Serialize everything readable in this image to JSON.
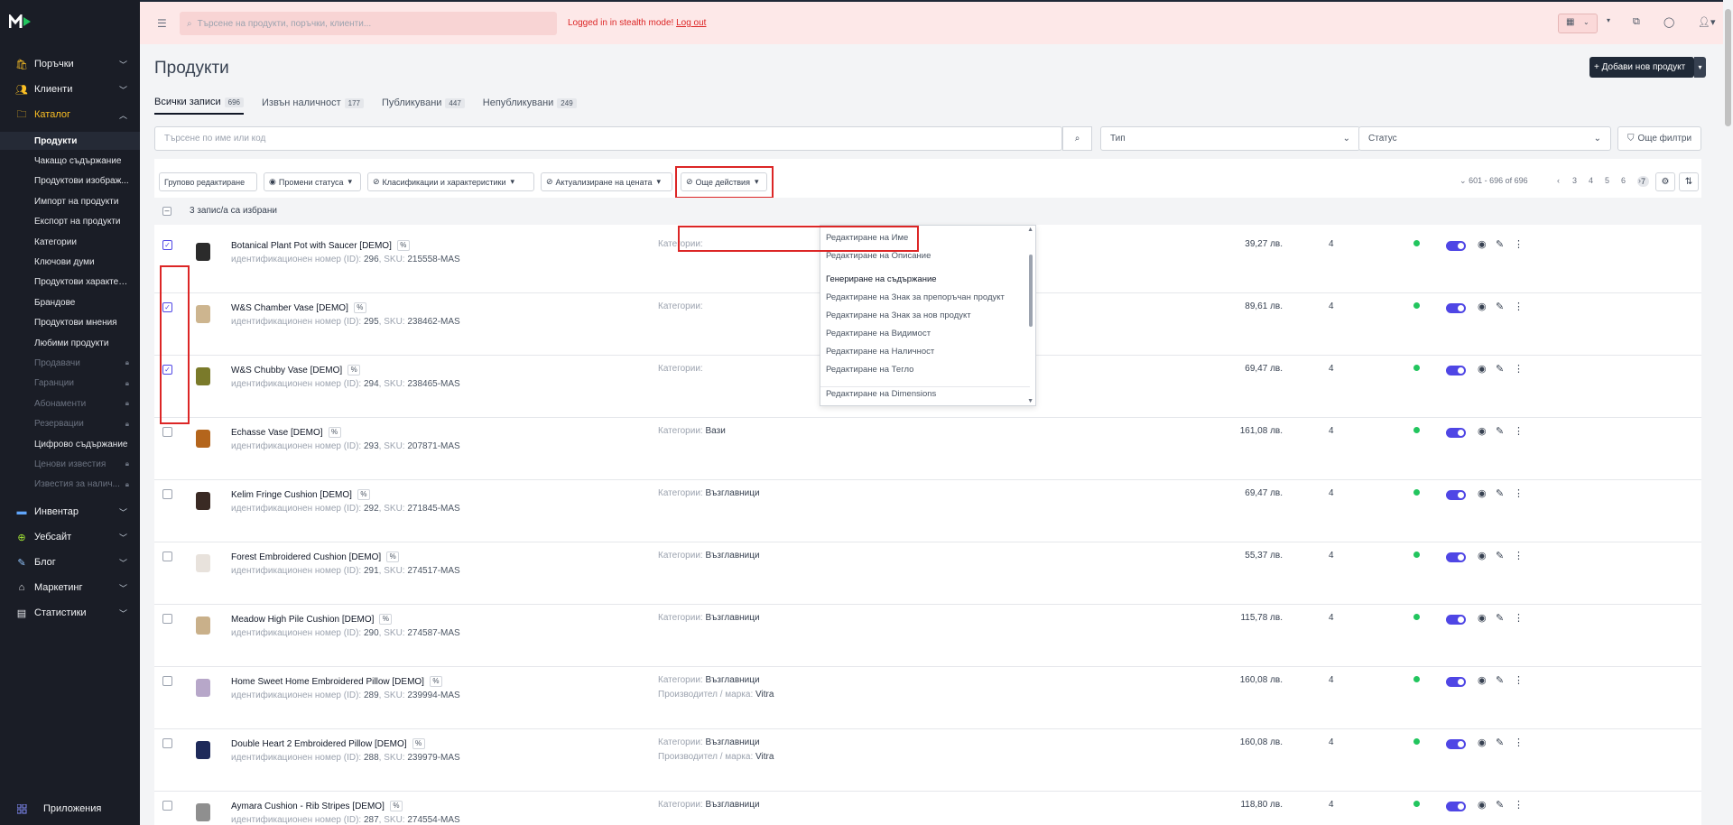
{
  "sidebar": {
    "main_top": [
      {
        "label": "Поръчки",
        "icon": "orders-icon"
      },
      {
        "label": "Клиенти",
        "icon": "customers-icon"
      },
      {
        "label": "Каталог",
        "icon": "folder-icon"
      }
    ],
    "catalog_items": [
      {
        "label": "Продукти",
        "locked": false,
        "current": true
      },
      {
        "label": "Чакащо съдържание",
        "locked": false
      },
      {
        "label": "Продуктови изображ...",
        "locked": false
      },
      {
        "label": "Импорт на продукти",
        "locked": false
      },
      {
        "label": "Експорт на продукти",
        "locked": false
      },
      {
        "label": "Категории",
        "locked": false
      },
      {
        "label": "Ключови думи",
        "locked": false
      },
      {
        "label": "Продуктови характер...",
        "locked": false
      },
      {
        "label": "Брандове",
        "locked": false
      },
      {
        "label": "Продуктови мнения",
        "locked": false
      },
      {
        "label": "Любими продукти",
        "locked": false
      },
      {
        "label": "Продавачи",
        "locked": true
      },
      {
        "label": "Гаранции",
        "locked": true
      },
      {
        "label": "Абонаменти",
        "locked": true
      },
      {
        "label": "Резервации",
        "locked": true
      },
      {
        "label": "Цифрово съдържание",
        "locked": false
      },
      {
        "label": "Ценови известия",
        "locked": true
      },
      {
        "label": "Известия за налич...",
        "locked": true
      }
    ],
    "main_bottom": [
      {
        "label": "Инвентар",
        "icon": "inventory-icon"
      },
      {
        "label": "Уебсайт",
        "icon": "website-icon"
      },
      {
        "label": "Блог",
        "icon": "blog-icon"
      },
      {
        "label": "Маркетинг",
        "icon": "tag-icon"
      },
      {
        "label": "Статистики",
        "icon": "stats-icon"
      }
    ],
    "apps_label": "Приложения"
  },
  "topbar": {
    "search_placeholder": "Търсене на продукти, поръчки, клиенти...",
    "stealth_text": "Logged in in stealth mode!",
    "logout_label": "Log out"
  },
  "page": {
    "title": "Продукти",
    "add_button": "+ Добави нов продукт"
  },
  "tabs": [
    {
      "label": "Всички записи",
      "count": "696"
    },
    {
      "label": "Извън наличност",
      "count": "177"
    },
    {
      "label": "Публикувани",
      "count": "447"
    },
    {
      "label": "Непубликувани",
      "count": "249"
    }
  ],
  "filters": {
    "search_placeholder": "Търсене по име или код",
    "type_placeholder": "Тип",
    "status_placeholder": "Статус",
    "more_filters": "Още филтри"
  },
  "actions": {
    "bulk_edit": "Групово редактиране",
    "change_status": "Промени статуса",
    "classifications": "Класификации и характеристики",
    "price_update": "Актуализиране на цената",
    "more_actions": "Още действия"
  },
  "pagination": {
    "range": "601 - 696 of 696",
    "pages": [
      "3",
      "4",
      "5",
      "6",
      "7"
    ],
    "current": "7"
  },
  "selection_text": "3 запис/а са избрани",
  "dropdown_items": [
    "Редактиране на Име",
    "Редактиране на Описание",
    "Генериране на съдържание",
    "Редактиране на Знак за препоръчан продукт",
    "Редактиране на Знак за нов продукт",
    "Редактиране на Видимост",
    "Редактиране на Наличност",
    "Редактиране на Тегло",
    "Редактиране на Dimensions"
  ],
  "labels": {
    "id_prefix": "идентификационен номер (ID):",
    "sku_prefix": "SKU:",
    "category_prefix": "Категории:",
    "brand_prefix": "Производител / марка:"
  },
  "products": [
    {
      "name": "Botanical Plant Pot with Saucer [DEMO]",
      "id": "296",
      "sku": "215558-MAS",
      "category": "",
      "brand": "",
      "price": "39,27 лв.",
      "qty": "4",
      "checked": true,
      "thumb_color": "#2b2b2b"
    },
    {
      "name": "W&S Chamber Vase [DEMO]",
      "id": "295",
      "sku": "238462-MAS",
      "category": "",
      "brand": "",
      "price": "89,61 лв.",
      "qty": "4",
      "checked": true,
      "thumb_color": "#cdb58f"
    },
    {
      "name": "W&S Chubby Vase [DEMO]",
      "id": "294",
      "sku": "238465-MAS",
      "category": "",
      "brand": "",
      "price": "69,47 лв.",
      "qty": "4",
      "checked": true,
      "thumb_color": "#7a7a2a"
    },
    {
      "name": "Echasse Vase [DEMO]",
      "id": "293",
      "sku": "207871-MAS",
      "category": "Вази",
      "brand": "",
      "price": "161,08 лв.",
      "qty": "4",
      "checked": false,
      "thumb_color": "#b4651c"
    },
    {
      "name": "Kelim Fringe Cushion [DEMO]",
      "id": "292",
      "sku": "271845-MAS",
      "category": "Възглавници",
      "brand": "",
      "price": "69,47 лв.",
      "qty": "4",
      "checked": false,
      "thumb_color": "#3a2a24"
    },
    {
      "name": "Forest Embroidered Cushion [DEMO]",
      "id": "291",
      "sku": "274517-MAS",
      "category": "Възглавници",
      "brand": "",
      "price": "55,37 лв.",
      "qty": "4",
      "checked": false,
      "thumb_color": "#e8e2dc"
    },
    {
      "name": "Meadow High Pile Cushion [DEMO]",
      "id": "290",
      "sku": "274587-MAS",
      "category": "Възглавници",
      "brand": "",
      "price": "115,78 лв.",
      "qty": "4",
      "checked": false,
      "thumb_color": "#c9b08a"
    },
    {
      "name": "Home Sweet Home Embroidered Pillow [DEMO]",
      "id": "289",
      "sku": "239994-MAS",
      "category": "Възглавници",
      "brand": "Vitra",
      "price": "160,08 лв.",
      "qty": "4",
      "checked": false,
      "thumb_color": "#b7a7c9"
    },
    {
      "name": "Double Heart 2 Embroidered Pillow [DEMO]",
      "id": "288",
      "sku": "239979-MAS",
      "category": "Възглавници",
      "brand": "Vitra",
      "price": "160,08 лв.",
      "qty": "4",
      "checked": false,
      "thumb_color": "#1e2a5a"
    },
    {
      "name": "Aymara Cushion - Rib Stripes [DEMO]",
      "id": "287",
      "sku": "274554-MAS",
      "category": "Възглавници",
      "brand": "",
      "price": "118,80 лв.",
      "qty": "4",
      "checked": false,
      "thumb_color": "#8f8f8f"
    }
  ],
  "colors": {
    "accent": "#4f46e5",
    "highlight": "#dc2626",
    "sidebar_bg": "#1a1d26",
    "topbar_bg": "#fde8e8"
  }
}
